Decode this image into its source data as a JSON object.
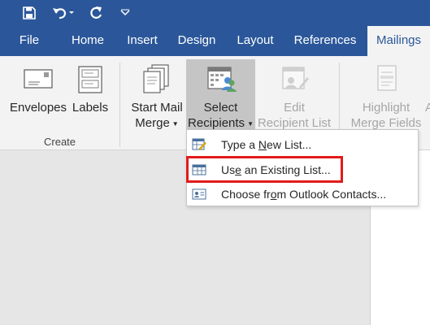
{
  "quick_access": {
    "save_icon": "save-icon",
    "undo_icon": "undo-icon",
    "redo_icon": "redo-icon",
    "customize_icon": "chevron-down-icon"
  },
  "tabs": [
    {
      "label": "File"
    },
    {
      "label": "Home"
    },
    {
      "label": "Insert"
    },
    {
      "label": "Design"
    },
    {
      "label": "Layout"
    },
    {
      "label": "References"
    },
    {
      "label": "Mailings",
      "active": true
    }
  ],
  "ribbon": {
    "envelopes": "Envelopes",
    "labels": "Labels",
    "create_group": "Create",
    "start_mail_merge_line1": "Start Mail",
    "start_mail_merge_line2": "Merge",
    "select_recipients_line1": "Select",
    "select_recipients_line2": "Recipients",
    "edit_recipient_list_line1": "Edit",
    "edit_recipient_list_line2": "Recipient List",
    "highlight_merge_fields_line1": "Highlight",
    "highlight_merge_fields_line2": "Merge Fields",
    "clipped_next_button": "A"
  },
  "menu": {
    "items": [
      {
        "pre": "Type a ",
        "key": "N",
        "post": "ew List...",
        "icon": "table-edit-icon"
      },
      {
        "pre": "Us",
        "key": "e",
        "post": " an Existing List...",
        "icon": "table-icon",
        "highlighted": true
      },
      {
        "pre": "Choose fr",
        "key": "o",
        "post": "m Outlook Contacts...",
        "icon": "contact-card-icon"
      }
    ]
  },
  "colors": {
    "accent": "#2b579a",
    "ribbon_bg": "#f3f3f3",
    "highlight_box": "#e21b1b"
  }
}
